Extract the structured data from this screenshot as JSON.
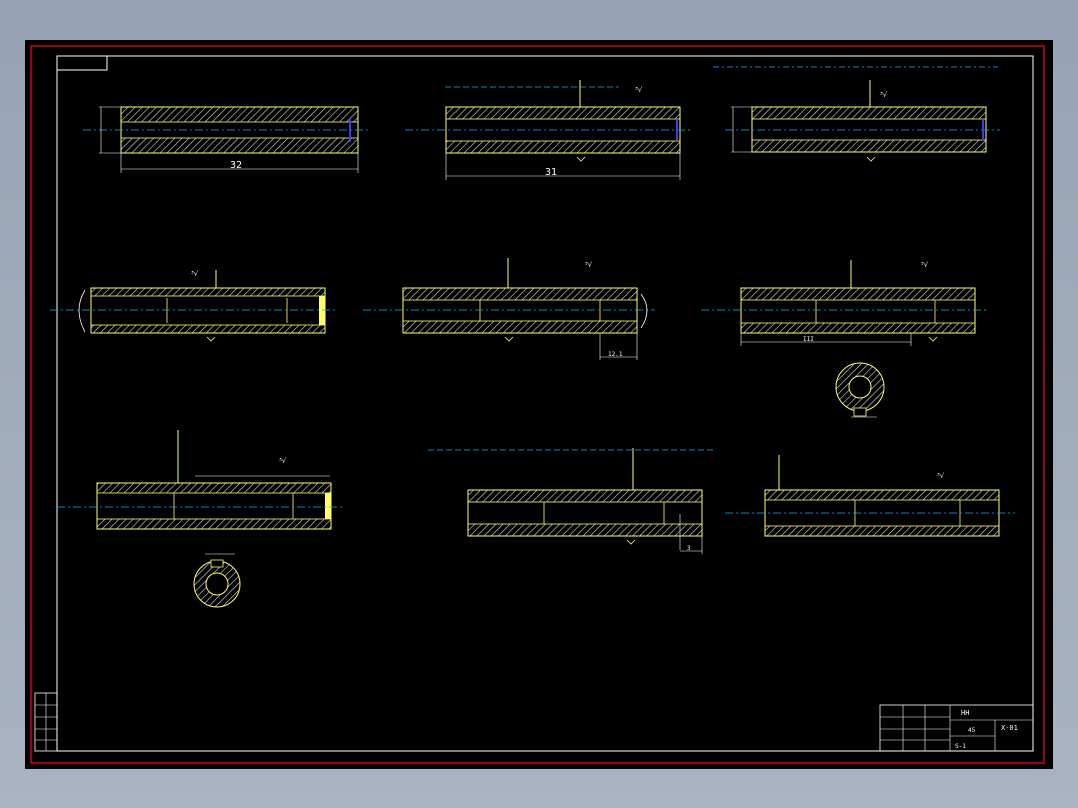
{
  "drawing": {
    "dimensions": {
      "d1_length": "32",
      "d2_length": "31",
      "d6_length": "III",
      "d5_detail": "12.1",
      "d8_detail": "3"
    },
    "surface_marks": [
      "³√",
      "³√",
      "³√",
      "³√",
      "³√",
      "³√",
      "³√"
    ],
    "title_block": {
      "name_label": "HH",
      "drawing_no": "X-01",
      "scale_label": "S-1",
      "material_label": "45"
    }
  },
  "colors": {
    "background": "#000000",
    "outer_border": "#d0021b",
    "frame": "#ffffff",
    "part_outline": "#ffff66",
    "hatch": "#e6e6e6",
    "centerline": "#00b4ff",
    "hidden_line": "#3a3aff"
  }
}
